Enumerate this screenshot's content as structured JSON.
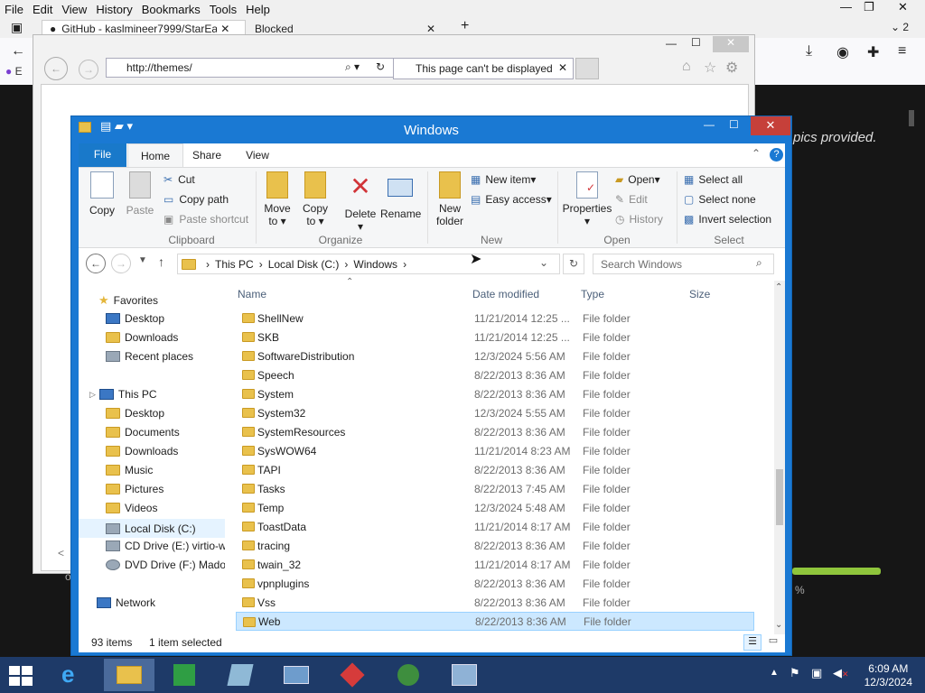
{
  "firefox": {
    "menu": [
      "File",
      "Edit",
      "View",
      "History",
      "Bookmarks",
      "Tools",
      "Help"
    ],
    "tabs": [
      {
        "label": "GitHub - kaslmineer7999/StarEa"
      },
      {
        "label": "Blocked"
      }
    ],
    "new_tab": "+",
    "tab_count": "2",
    "right_text": "pics provided.",
    "left_letter": "E",
    "bg_percent": "%",
    "bg_letter": "o"
  },
  "ie": {
    "address": "http://themes/",
    "tab_label": "This page can't be displayed"
  },
  "explorer": {
    "title": "Windows",
    "ribbon_tabs": {
      "file": "File",
      "home": "Home",
      "share": "Share",
      "view": "View"
    },
    "clipboard": {
      "copy": "Copy",
      "paste": "Paste",
      "cut": "Cut",
      "copy_path": "Copy path",
      "paste_shortcut": "Paste shortcut",
      "group": "Clipboard"
    },
    "organize": {
      "move_to": "Move",
      "move_to2": "to",
      "copy_to": "Copy",
      "copy_to2": "to",
      "delete": "Delete",
      "rename": "Rename",
      "group": "Organize"
    },
    "new": {
      "new_folder": "New",
      "new_folder2": "folder",
      "new_item": "New item",
      "easy_access": "Easy access",
      "group": "New"
    },
    "open": {
      "properties": "Properties",
      "open": "Open",
      "edit": "Edit",
      "history": "History",
      "group": "Open"
    },
    "select": {
      "select_all": "Select all",
      "select_none": "Select none",
      "invert": "Invert selection",
      "group": "Select"
    },
    "path": [
      "This PC",
      "Local Disk (C:)",
      "Windows"
    ],
    "search_placeholder": "Search Windows",
    "nav": {
      "favorites": "Favorites",
      "fav_items": [
        "Desktop",
        "Downloads",
        "Recent places"
      ],
      "this_pc": "This PC",
      "pc_items": [
        "Desktop",
        "Documents",
        "Downloads",
        "Music",
        "Pictures",
        "Videos",
        "Local Disk (C:)",
        "CD Drive (E:) virtio-w",
        "DVD Drive (F:) Mado"
      ],
      "network": "Network"
    },
    "columns": {
      "name": "Name",
      "date": "Date modified",
      "type": "Type",
      "size": "Size"
    },
    "files": [
      {
        "name": "ShellNew",
        "date": "11/21/2014 12:25 ...",
        "type": "File folder"
      },
      {
        "name": "SKB",
        "date": "11/21/2014 12:25 ...",
        "type": "File folder"
      },
      {
        "name": "SoftwareDistribution",
        "date": "12/3/2024 5:56 AM",
        "type": "File folder"
      },
      {
        "name": "Speech",
        "date": "8/22/2013 8:36 AM",
        "type": "File folder"
      },
      {
        "name": "System",
        "date": "8/22/2013 8:36 AM",
        "type": "File folder"
      },
      {
        "name": "System32",
        "date": "12/3/2024 5:55 AM",
        "type": "File folder"
      },
      {
        "name": "SystemResources",
        "date": "8/22/2013 8:36 AM",
        "type": "File folder"
      },
      {
        "name": "SysWOW64",
        "date": "11/21/2014 8:23 AM",
        "type": "File folder"
      },
      {
        "name": "TAPI",
        "date": "8/22/2013 8:36 AM",
        "type": "File folder"
      },
      {
        "name": "Tasks",
        "date": "8/22/2013 7:45 AM",
        "type": "File folder"
      },
      {
        "name": "Temp",
        "date": "12/3/2024 5:48 AM",
        "type": "File folder"
      },
      {
        "name": "ToastData",
        "date": "11/21/2014 8:17 AM",
        "type": "File folder"
      },
      {
        "name": "tracing",
        "date": "8/22/2013 8:36 AM",
        "type": "File folder"
      },
      {
        "name": "twain_32",
        "date": "11/21/2014 8:17 AM",
        "type": "File folder"
      },
      {
        "name": "vpnplugins",
        "date": "8/22/2013 8:36 AM",
        "type": "File folder"
      },
      {
        "name": "Vss",
        "date": "8/22/2013 8:36 AM",
        "type": "File folder"
      },
      {
        "name": "Web",
        "date": "8/22/2013 8:36 AM",
        "type": "File folder"
      }
    ],
    "selected_index": 16,
    "status_items": "93 items",
    "status_selected": "1 item selected"
  },
  "taskbar": {
    "time": "6:09 AM",
    "date": "12/3/2024"
  },
  "colors": {
    "explorer_frame": "#1a79d3",
    "taskbar": "#1e3a68",
    "close_red": "#c6403a",
    "selection": "#cce8ff"
  }
}
